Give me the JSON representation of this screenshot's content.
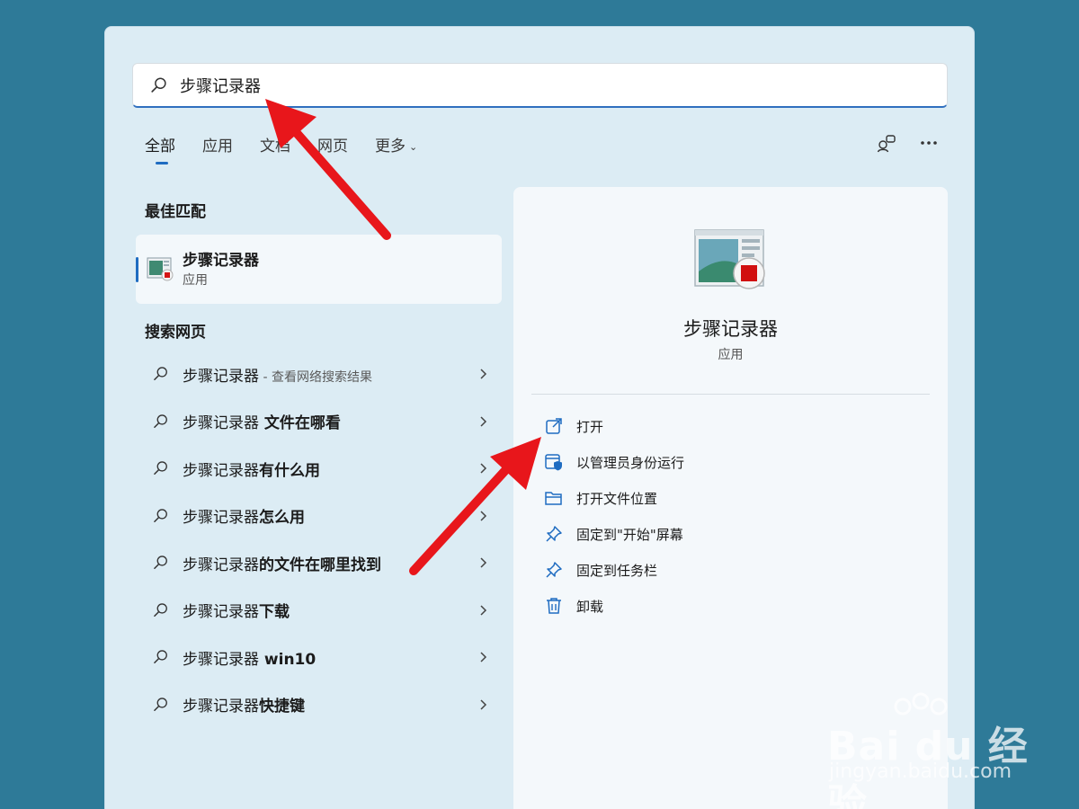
{
  "search": {
    "query": "步骤记录器"
  },
  "tabs": [
    {
      "label": "全部"
    },
    {
      "label": "应用"
    },
    {
      "label": "文档"
    },
    {
      "label": "网页"
    },
    {
      "label": "更多"
    }
  ],
  "best_match": {
    "title": "最佳匹配",
    "app_name": "步骤记录器",
    "app_type": "应用"
  },
  "web_search": {
    "title": "搜索网页",
    "items": [
      {
        "prefix": "步骤记录器",
        "bold": "",
        "hint": " - 查看网络搜索结果"
      },
      {
        "prefix": "步骤记录器",
        "bold": " 文件在哪看",
        "hint": ""
      },
      {
        "prefix": "步骤记录器",
        "bold": "有什么用",
        "hint": ""
      },
      {
        "prefix": "步骤记录器",
        "bold": "怎么用",
        "hint": ""
      },
      {
        "prefix": "步骤记录器",
        "bold": "的文件在哪里找到",
        "hint": ""
      },
      {
        "prefix": "步骤记录器",
        "bold": "下载",
        "hint": ""
      },
      {
        "prefix": "步骤记录器",
        "bold": " win10",
        "hint": ""
      },
      {
        "prefix": "步骤记录器",
        "bold": "快捷键",
        "hint": ""
      }
    ]
  },
  "detail": {
    "app_name": "步骤记录器",
    "app_type": "应用",
    "actions": [
      {
        "label": "打开",
        "icon": "open-external-icon"
      },
      {
        "label": "以管理员身份运行",
        "icon": "admin-shield-icon"
      },
      {
        "label": "打开文件位置",
        "icon": "folder-icon"
      },
      {
        "label": "固定到\"开始\"屏幕",
        "icon": "pin-icon"
      },
      {
        "label": "固定到任务栏",
        "icon": "pin-icon"
      },
      {
        "label": "卸载",
        "icon": "trash-icon"
      }
    ]
  },
  "watermark": {
    "brand": "Bai du 经验",
    "url": "jingyan.baidu.com"
  },
  "colors": {
    "background": "#2e7a98",
    "panel": "#dcecf4",
    "accent": "#1f6cc1",
    "arrow": "#e8161b"
  }
}
